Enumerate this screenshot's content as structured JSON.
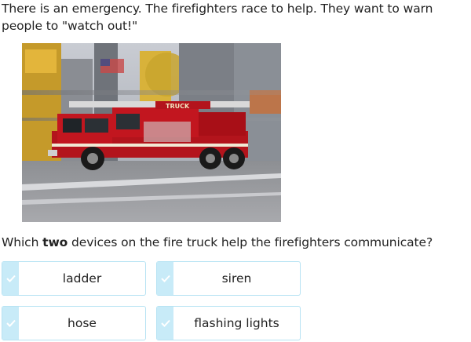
{
  "prompt": {
    "text": "There is an emergency. The firefighters race to help. They want to warn people to \"watch out!\""
  },
  "image": {
    "truck_lettering": "TRUCK"
  },
  "question": {
    "before": "Which ",
    "bold": "two",
    "after": " devices on the fire truck help the firefighters communicate?"
  },
  "choices": [
    {
      "label": "ladder",
      "icon": "check-icon"
    },
    {
      "label": "siren",
      "icon": "check-icon"
    },
    {
      "label": "hose",
      "icon": "check-icon"
    },
    {
      "label": "flashing lights",
      "icon": "check-icon"
    }
  ],
  "colors": {
    "choice_border": "#b7e3f3",
    "choice_tab": "#c8ebf8",
    "check": "#ffffff",
    "truck_red": "#b3141c"
  }
}
